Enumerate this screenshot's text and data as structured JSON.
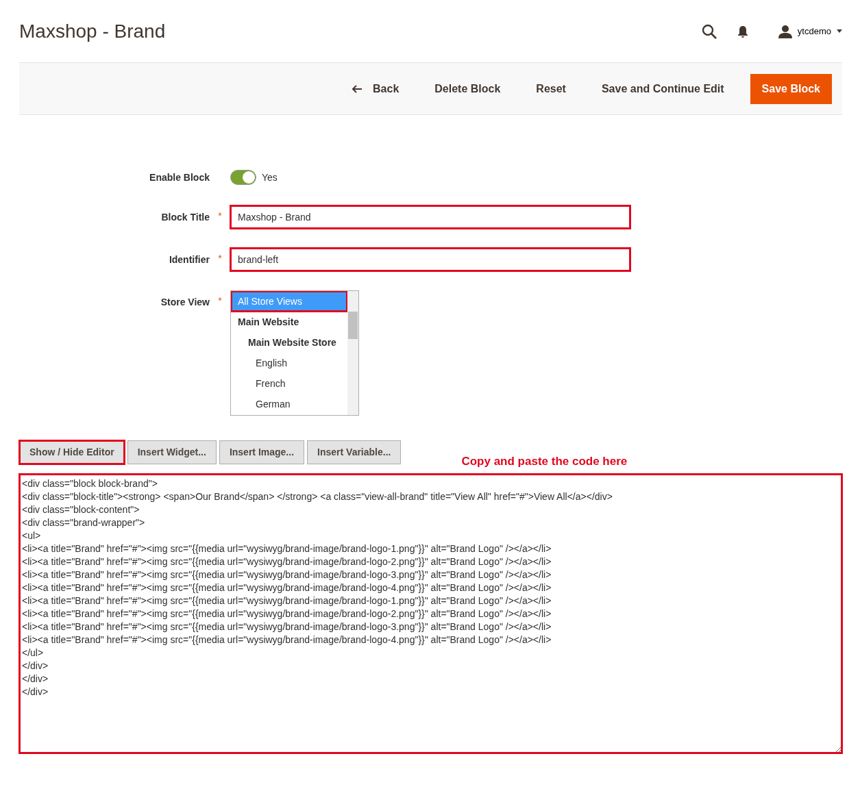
{
  "page_title": "Maxshop - Brand",
  "header": {
    "username": "ytcdemo"
  },
  "actions": [
    {
      "label": "Back",
      "kind": "back"
    },
    {
      "label": "Delete Block",
      "kind": "link"
    },
    {
      "label": "Reset",
      "kind": "link"
    },
    {
      "label": "Save and Continue Edit",
      "kind": "link"
    },
    {
      "label": "Save Block",
      "kind": "primary"
    }
  ],
  "form": {
    "enable_block": {
      "label": "Enable Block",
      "on": true,
      "value_text": "Yes"
    },
    "block_title": {
      "label": "Block Title",
      "required_mark": "*",
      "value": "Maxshop - Brand",
      "highlighted": true
    },
    "identifier": {
      "label": "Identifier",
      "required_mark": "*",
      "value": "brand-left",
      "highlighted": true
    },
    "store_view": {
      "label": "Store View",
      "required_mark": "*",
      "options": [
        {
          "label": "All Store Views",
          "selected": true,
          "highlighted": true,
          "bold": false
        },
        {
          "label": "Main Website",
          "selected": false,
          "highlighted": false,
          "bold": true,
          "children": [
            {
              "label": "Main Website Store",
              "selected": false,
              "highlighted": false,
              "bold": true,
              "children": [
                {
                  "label": "English",
                  "selected": false,
                  "highlighted": false,
                  "bold": false
                },
                {
                  "label": "French",
                  "selected": false,
                  "highlighted": false,
                  "bold": false
                },
                {
                  "label": "German",
                  "selected": false,
                  "highlighted": false,
                  "bold": false
                }
              ]
            }
          ]
        }
      ]
    }
  },
  "editor_buttons": [
    {
      "label": "Show / Hide Editor",
      "highlighted": true
    },
    {
      "label": "Insert Widget...",
      "highlighted": false
    },
    {
      "label": "Insert Image...",
      "highlighted": false
    },
    {
      "label": "Insert Variable...",
      "highlighted": false
    }
  ],
  "annotation": "Copy and paste the code here",
  "content": {
    "highlighted": true,
    "lines": [
      "<div class=\"block block-brand\">",
      "<div class=\"block-title\"><strong> <span>Our Brand</span> </strong> <a class=\"view-all-brand\" title=\"View All\" href=\"#\">View All</a></div>",
      "<div class=\"block-content\">",
      "<div class=\"brand-wrapper\">",
      "<ul>",
      "<li><a title=\"Brand\" href=\"#\"><img src=\"{{media url=\"wysiwyg/brand-image/brand-logo-1.png\"}}\" alt=\"Brand Logo\" /></a></li>",
      "<li><a title=\"Brand\" href=\"#\"><img src=\"{{media url=\"wysiwyg/brand-image/brand-logo-2.png\"}}\" alt=\"Brand Logo\" /></a></li>",
      "<li><a title=\"Brand\" href=\"#\"><img src=\"{{media url=\"wysiwyg/brand-image/brand-logo-3.png\"}}\" alt=\"Brand Logo\" /></a></li>",
      "<li><a title=\"Brand\" href=\"#\"><img src=\"{{media url=\"wysiwyg/brand-image/brand-logo-4.png\"}}\" alt=\"Brand Logo\" /></a></li>",
      "<li><a title=\"Brand\" href=\"#\"><img src=\"{{media url=\"wysiwyg/brand-image/brand-logo-1.png\"}}\" alt=\"Brand Logo\" /></a></li>",
      "<li><a title=\"Brand\" href=\"#\"><img src=\"{{media url=\"wysiwyg/brand-image/brand-logo-2.png\"}}\" alt=\"Brand Logo\" /></a></li>",
      "<li><a title=\"Brand\" href=\"#\"><img src=\"{{media url=\"wysiwyg/brand-image/brand-logo-3.png\"}}\" alt=\"Brand Logo\" /></a></li>",
      "<li><a title=\"Brand\" href=\"#\"><img src=\"{{media url=\"wysiwyg/brand-image/brand-logo-4.png\"}}\" alt=\"Brand Logo\" /></a></li>",
      "</ul>",
      "</div>",
      "</div>",
      "</div>"
    ]
  }
}
